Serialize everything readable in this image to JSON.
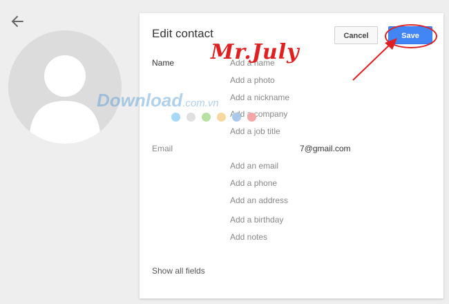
{
  "dialog": {
    "title": "Edit contact",
    "cancel_label": "Cancel",
    "save_label": "Save"
  },
  "sections": {
    "name_label": "Name",
    "email_label": "Email",
    "email_value": "7@gmail.com",
    "show_all": "Show all fields"
  },
  "fields": {
    "add_name": "Add a name",
    "add_photo": "Add a photo",
    "add_nickname": "Add a nickname",
    "add_company": "Add a company",
    "add_job_title": "Add a job title",
    "add_email": "Add an email",
    "add_phone": "Add a phone",
    "add_address": "Add an address",
    "add_birthday": "Add a birthday",
    "add_notes": "Add notes"
  },
  "icons": {
    "back": "arrow-left-icon",
    "avatar": "person-silhouette-icon"
  },
  "overlays": {
    "annotation": "Mr.July",
    "watermark": "Download",
    "watermark_suffix": ".com.vn"
  },
  "colors": {
    "accent": "#4285f4",
    "annotation": "#e02020",
    "dots": [
      "#a7d8f5",
      "#e0e0e0",
      "#b8e0a0",
      "#f7d9a0",
      "#a9c8ec",
      "#f4a7a7"
    ]
  }
}
